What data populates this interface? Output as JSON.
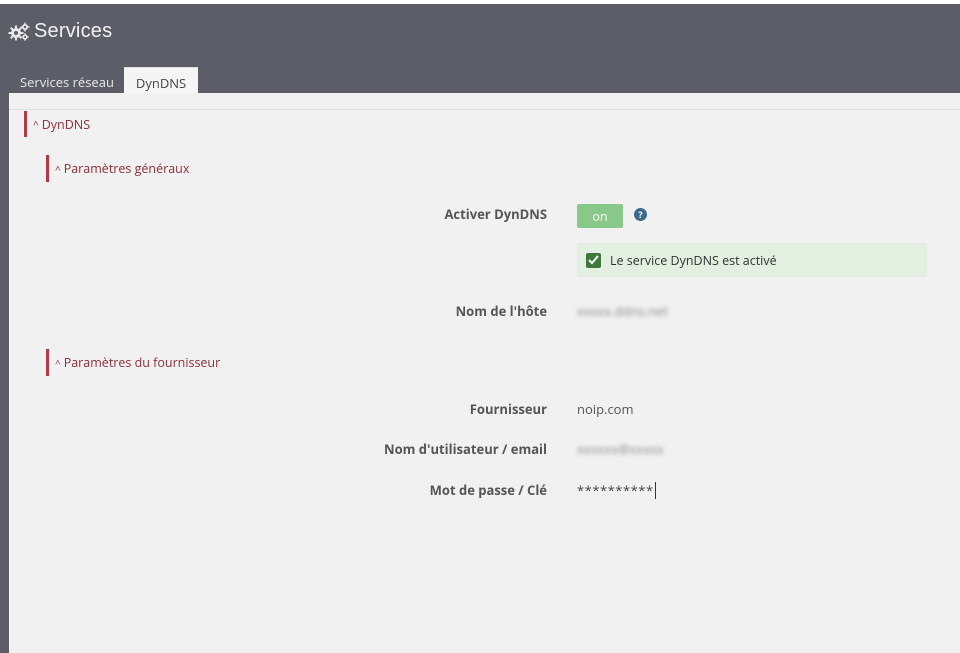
{
  "header": {
    "title": "Services",
    "icon": "gears-icon"
  },
  "tabs": [
    {
      "label": "Services réseau",
      "active": false
    },
    {
      "label": "DynDNS",
      "active": true
    }
  ],
  "sections": {
    "dyndns": {
      "label": "DynDNS"
    },
    "general": {
      "label": "Paramètres généraux"
    },
    "provider": {
      "label": "Paramètres du fournisseur"
    }
  },
  "form": {
    "activate_label": "Activer DynDNS",
    "toggle_label": "on",
    "toggle_on": true,
    "help": "?",
    "status_message": "Le service DynDNS est activé",
    "hostname_label": "Nom de l'hôte",
    "hostname_value": "xxxxx.ddns.net",
    "provider_label": "Fournisseur",
    "provider_value": "noip.com",
    "username_label": "Nom d'utilisateur / email",
    "username_value": "xxxxxx@xxxxx",
    "password_label": "Mot de passe / Clé",
    "password_value": "**********"
  },
  "colors": {
    "header_bg": "#5c5d66",
    "content_bg": "#f1f1f1",
    "section_accent": "#b03a48",
    "toggle_on": "#88c98a",
    "alert_bg": "#e3efe0"
  }
}
